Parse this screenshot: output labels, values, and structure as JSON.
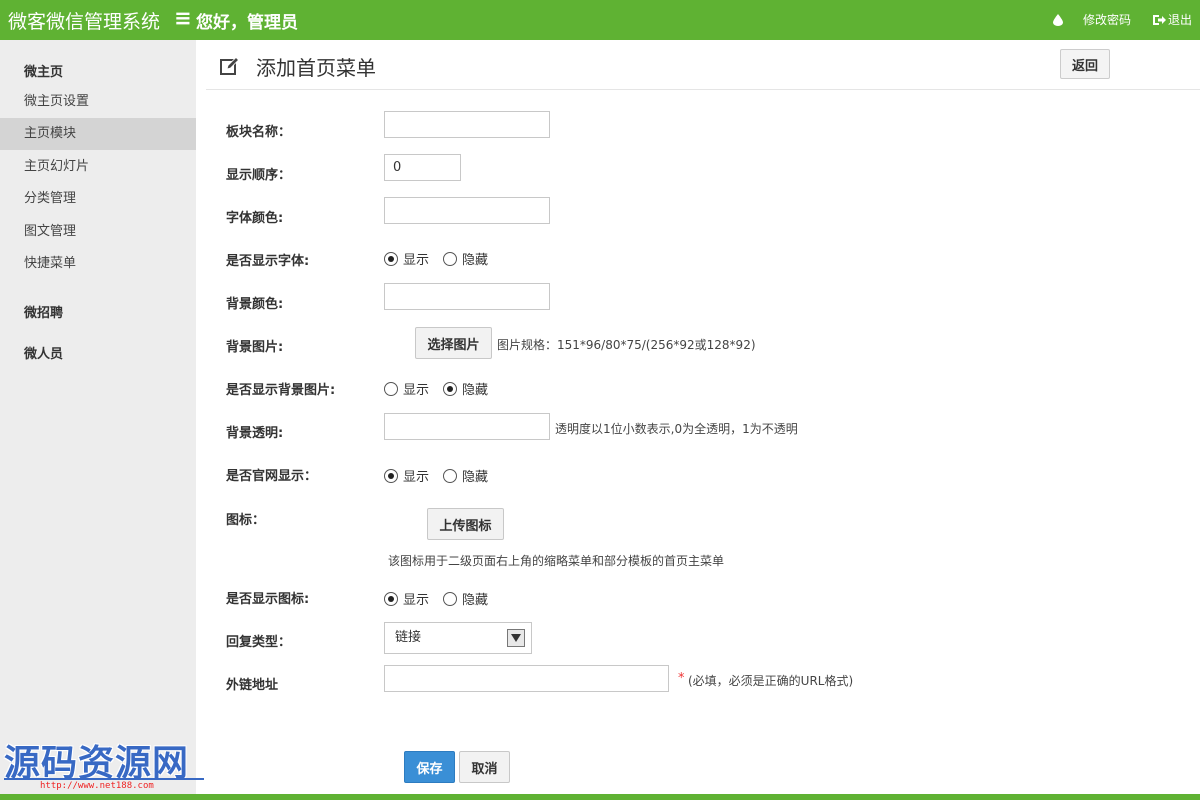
{
  "header": {
    "brand": "微客微信管理系统",
    "menu_toggle": "≡",
    "greeting": "您好，管理员",
    "change_password": "修改密码",
    "logout": "退出"
  },
  "sidebar": {
    "groups": [
      {
        "label": "微主页"
      },
      {
        "label": "微招聘"
      },
      {
        "label": "微人员"
      }
    ],
    "items": [
      {
        "label": "微主页设置",
        "active": false
      },
      {
        "label": "主页模块",
        "active": true
      },
      {
        "label": "主页幻灯片",
        "active": false
      },
      {
        "label": "分类管理",
        "active": false
      },
      {
        "label": "图文管理",
        "active": false
      },
      {
        "label": "快捷菜单",
        "active": false
      }
    ]
  },
  "page": {
    "title": "添加首页菜单",
    "back_label": "返回"
  },
  "form": {
    "block_name": {
      "label": "板块名称：",
      "value": ""
    },
    "display_order": {
      "label": "显示顺序：",
      "value": "0"
    },
    "font_color": {
      "label": "字体颜色:",
      "value": ""
    },
    "show_font": {
      "label": "是否显示字体:",
      "options": [
        "显示",
        "隐藏"
      ],
      "selected": "显示"
    },
    "bg_color": {
      "label": "背景颜色:",
      "value": ""
    },
    "bg_image": {
      "label": "背景图片:",
      "button": "选择图片",
      "hint": "图片规格：151*96/80*75/(256*92或128*92)"
    },
    "show_bg_image": {
      "label": "是否显示背景图片:",
      "options": [
        "显示",
        "隐藏"
      ],
      "selected": "隐藏"
    },
    "bg_opacity": {
      "label": "背景透明:",
      "value": "",
      "hint": "透明度以1位小数表示,0为全透明，1为不透明"
    },
    "show_on_site": {
      "label": "是否官网显示：",
      "options": [
        "显示",
        "隐藏"
      ],
      "selected": "显示"
    },
    "icon": {
      "label": "图标：",
      "button": "上传图标",
      "hint": "该图标用于二级页面右上角的缩略菜单和部分模板的首页主菜单"
    },
    "show_icon": {
      "label": "是否显示图标:",
      "options": [
        "显示",
        "隐藏"
      ],
      "selected": "显示"
    },
    "reply_type": {
      "label": "回复类型：",
      "value": "链接"
    },
    "external_link": {
      "label": "外链地址",
      "value": "",
      "required_mark": "*",
      "hint": "(必填，必须是正确的URL格式)"
    },
    "save_label": "保存",
    "cancel_label": "取消"
  },
  "watermark": {
    "text": "源码资源网",
    "url": "http://www.net188.com"
  },
  "colors": {
    "brand_green": "#5fb233",
    "save_blue": "#3a8fd6",
    "sidebar_bg": "#ededed",
    "sidebar_active": "#d4d4d4"
  }
}
